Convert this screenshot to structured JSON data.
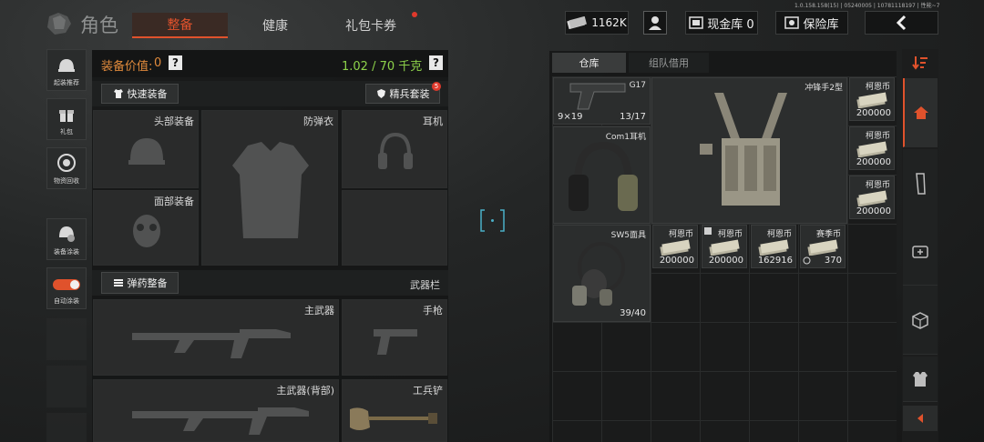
{
  "header": {
    "title": "角色",
    "tabs": [
      "整备",
      "健康",
      "礼包卡券"
    ],
    "active_tab": 0,
    "version_text": "1.0.158.158(15) | 05240005 | 10781118197 | 性能~7",
    "currency_value": "1162K",
    "cash_vault_label": "现金库 0",
    "safe_label": "保险库"
  },
  "left_sidebar": {
    "items": [
      "起装推荐",
      "礼包",
      "物资回收",
      "装备涂装",
      "自动涂装"
    ]
  },
  "equipment": {
    "value_label": "装备价值:",
    "value": "0",
    "weight": "1.02 / 70 千克",
    "help": "?",
    "quick_equip": "快速装备",
    "elite_set": "精兵套装",
    "elite_badge": "5",
    "slots": {
      "head": "头部装备",
      "armor": "防弹衣",
      "ear": "耳机",
      "face": "面部装备",
      "ammo_button": "弹药整备",
      "weapon_bar": "武器栏",
      "primary": "主武器",
      "pistol": "手枪",
      "primary_back": "主武器(背部)",
      "shovel": "工兵铲"
    }
  },
  "storage": {
    "tabs": [
      "仓库",
      "组队借用"
    ],
    "active_tab": 0,
    "items": {
      "g17": {
        "name": "G17",
        "caliber": "9×19",
        "ammo": "13/17"
      },
      "vest": {
        "name": "冲锋手2型"
      },
      "com1": {
        "name": "Com1耳机"
      },
      "sw5": {
        "name": "SW5面具",
        "durability": "39/40"
      }
    },
    "money": [
      {
        "label": "柯恩币",
        "qty": "200000"
      },
      {
        "label": "柯恩币",
        "qty": "200000"
      },
      {
        "label": "柯恩币",
        "qty": "200000"
      },
      {
        "label": "柯恩币",
        "qty": "200000"
      },
      {
        "label": "柯恩币",
        "qty": "200000"
      },
      {
        "label": "柯恩币",
        "qty": "162916"
      },
      {
        "label": "赛季币",
        "qty": "370"
      }
    ]
  },
  "colors": {
    "accent": "#e0522c",
    "weight_green": "#8dd24a",
    "value_orange": "#e08a3c"
  }
}
